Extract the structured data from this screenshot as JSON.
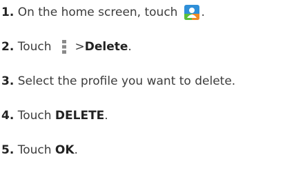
{
  "steps": [
    {
      "num": "1.",
      "text_before": "On the home screen, touch",
      "icon": "contacts-app-icon",
      "text_after": "."
    },
    {
      "num": "2.",
      "text_before": "Touch",
      "icon": "overflow-menu-icon",
      "text_mid": "> ",
      "bold": "Delete",
      "text_after": "."
    },
    {
      "num": "3.",
      "text_before": "Select the profile you want to delete."
    },
    {
      "num": "4.",
      "text_before": "Touch ",
      "bold": "DELETE",
      "text_after": "."
    },
    {
      "num": "5.",
      "text_before": "Touch ",
      "bold": "OK",
      "text_after": "."
    }
  ],
  "colors": {
    "icon_blue": "#2f8fd8",
    "icon_green": "#5bbf3a",
    "icon_orange": "#f08a24",
    "menu_dots": "#8a8a8a"
  }
}
